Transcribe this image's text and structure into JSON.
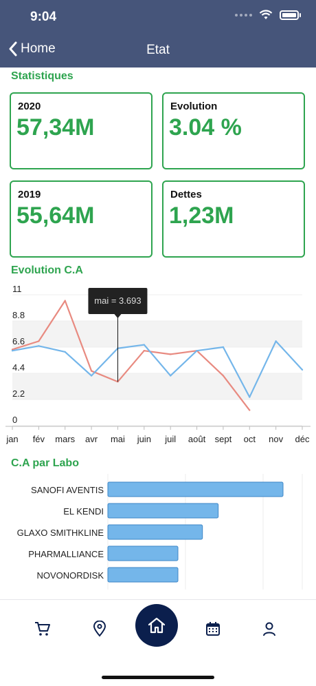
{
  "status_bar": {
    "time": "9:04"
  },
  "nav": {
    "back_label": "Home",
    "title": "Etat"
  },
  "sections": {
    "stats": "Statistiques",
    "evolution": "Evolution C.A",
    "labo": "C.A par Labo"
  },
  "stats": [
    {
      "label": "2020",
      "value": "57,34M"
    },
    {
      "label": "Evolution",
      "value": "3.04 %"
    },
    {
      "label": "2019",
      "value": "55,64M"
    },
    {
      "label": "Dettes",
      "value": "1,23M"
    }
  ],
  "colors": {
    "accent": "#2ea44f",
    "header": "#46557a",
    "series_red": "#e88a80",
    "series_blue": "#74b6ea",
    "nav_dark": "#0b1f4d"
  },
  "chart_data": [
    {
      "type": "line",
      "title": "Evolution C.A",
      "categories": [
        "jan",
        "fév",
        "mars",
        "avr",
        "mai",
        "juin",
        "juil",
        "août",
        "sept",
        "oct",
        "nov",
        "déc"
      ],
      "y_ticks": [
        "0",
        "2.2",
        "4.4",
        "6.6",
        "8.8",
        "11"
      ],
      "ylim": [
        0,
        11
      ],
      "series": [
        {
          "color": "#e88a80",
          "values": [
            6.4,
            7.1,
            10.5,
            4.6,
            3.693,
            6.3,
            6.0,
            6.3,
            4.2,
            1.3,
            null,
            null
          ]
        },
        {
          "color": "#74b6ea",
          "values": [
            6.3,
            6.7,
            6.2,
            4.2,
            6.5,
            6.8,
            4.2,
            6.3,
            6.6,
            2.4,
            7.1,
            4.7
          ]
        }
      ],
      "tooltip": {
        "category": "mai",
        "text": "mai = 3.693"
      },
      "grid": true
    },
    {
      "type": "bar",
      "orientation": "horizontal",
      "title": "C.A par Labo",
      "categories": [
        "SANOFI AVENTIS",
        "EL KENDI",
        "GLAXO SMITHKLINE",
        "PHARMALLIANCE",
        "NOVONORDISK"
      ],
      "values": [
        100,
        63,
        54,
        40,
        40
      ]
    }
  ],
  "tabs": [
    {
      "name": "cart"
    },
    {
      "name": "location"
    },
    {
      "name": "home"
    },
    {
      "name": "calendar"
    },
    {
      "name": "profile"
    }
  ]
}
